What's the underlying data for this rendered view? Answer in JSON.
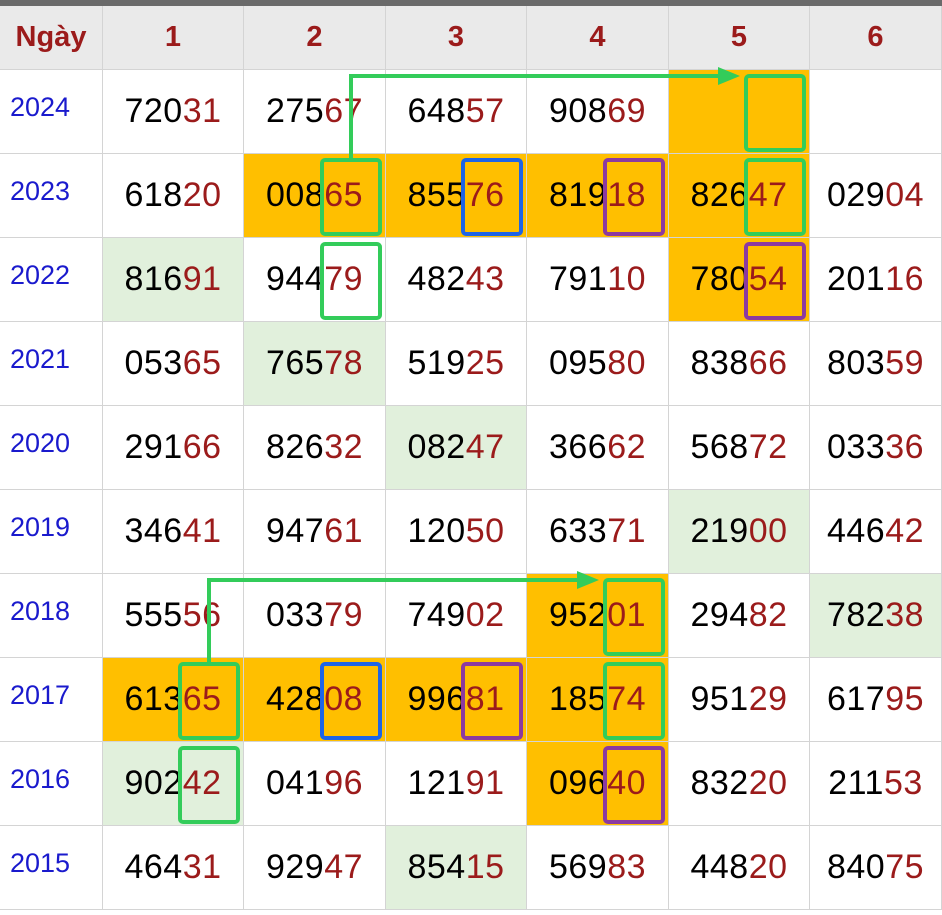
{
  "header": {
    "day_label": "Ngày",
    "columns": [
      "1",
      "2",
      "3",
      "4",
      "5",
      "6"
    ]
  },
  "rows": [
    {
      "year": "2024",
      "cells": [
        {
          "head": "720",
          "tail": "31",
          "bg": "white"
        },
        {
          "head": "275",
          "tail": "67",
          "bg": "white"
        },
        {
          "head": "648",
          "tail": "57",
          "bg": "white"
        },
        {
          "head": "908",
          "tail": "69",
          "bg": "white"
        },
        {
          "head": "",
          "tail": "",
          "bg": "gold"
        },
        {
          "head": "",
          "tail": "",
          "bg": "white"
        }
      ]
    },
    {
      "year": "2023",
      "cells": [
        {
          "head": "618",
          "tail": "20",
          "bg": "white"
        },
        {
          "head": "008",
          "tail": "65",
          "bg": "gold"
        },
        {
          "head": "855",
          "tail": "76",
          "bg": "gold"
        },
        {
          "head": "819",
          "tail": "18",
          "bg": "gold"
        },
        {
          "head": "826",
          "tail": "47",
          "bg": "gold"
        },
        {
          "head": "029",
          "tail": "04",
          "bg": "white"
        }
      ]
    },
    {
      "year": "2022",
      "cells": [
        {
          "head": "816",
          "tail": "91",
          "bg": "mint"
        },
        {
          "head": "944",
          "tail": "79",
          "bg": "white"
        },
        {
          "head": "482",
          "tail": "43",
          "bg": "white"
        },
        {
          "head": "791",
          "tail": "10",
          "bg": "white"
        },
        {
          "head": "780",
          "tail": "54",
          "bg": "gold"
        },
        {
          "head": "201",
          "tail": "16",
          "bg": "white"
        }
      ]
    },
    {
      "year": "2021",
      "cells": [
        {
          "head": "053",
          "tail": "65",
          "bg": "white"
        },
        {
          "head": "765",
          "tail": "78",
          "bg": "mint"
        },
        {
          "head": "519",
          "tail": "25",
          "bg": "white"
        },
        {
          "head": "095",
          "tail": "80",
          "bg": "white"
        },
        {
          "head": "838",
          "tail": "66",
          "bg": "white"
        },
        {
          "head": "803",
          "tail": "59",
          "bg": "white"
        }
      ]
    },
    {
      "year": "2020",
      "cells": [
        {
          "head": "291",
          "tail": "66",
          "bg": "white"
        },
        {
          "head": "826",
          "tail": "32",
          "bg": "white"
        },
        {
          "head": "082",
          "tail": "47",
          "bg": "mint"
        },
        {
          "head": "366",
          "tail": "62",
          "bg": "white"
        },
        {
          "head": "568",
          "tail": "72",
          "bg": "white"
        },
        {
          "head": "033",
          "tail": "36",
          "bg": "white"
        }
      ]
    },
    {
      "year": "2019",
      "cells": [
        {
          "head": "346",
          "tail": "41",
          "bg": "white"
        },
        {
          "head": "947",
          "tail": "61",
          "bg": "white"
        },
        {
          "head": "120",
          "tail": "50",
          "bg": "white"
        },
        {
          "head": "633",
          "tail": "71",
          "bg": "white"
        },
        {
          "head": "219",
          "tail": "00",
          "bg": "mint"
        },
        {
          "head": "446",
          "tail": "42",
          "bg": "white"
        }
      ]
    },
    {
      "year": "2018",
      "cells": [
        {
          "head": "555",
          "tail": "56",
          "bg": "white"
        },
        {
          "head": "033",
          "tail": "79",
          "bg": "white"
        },
        {
          "head": "749",
          "tail": "02",
          "bg": "white"
        },
        {
          "head": "952",
          "tail": "01",
          "bg": "gold"
        },
        {
          "head": "294",
          "tail": "82",
          "bg": "white"
        },
        {
          "head": "782",
          "tail": "38",
          "bg": "mint"
        }
      ]
    },
    {
      "year": "2017",
      "cells": [
        {
          "head": "613",
          "tail": "65",
          "bg": "gold"
        },
        {
          "head": "428",
          "tail": "08",
          "bg": "gold"
        },
        {
          "head": "996",
          "tail": "81",
          "bg": "gold"
        },
        {
          "head": "185",
          "tail": "74",
          "bg": "gold"
        },
        {
          "head": "951",
          "tail": "29",
          "bg": "white"
        },
        {
          "head": "617",
          "tail": "95",
          "bg": "white"
        }
      ]
    },
    {
      "year": "2016",
      "cells": [
        {
          "head": "902",
          "tail": "42",
          "bg": "mint"
        },
        {
          "head": "041",
          "tail": "96",
          "bg": "white"
        },
        {
          "head": "121",
          "tail": "91",
          "bg": "white"
        },
        {
          "head": "096",
          "tail": "40",
          "bg": "gold"
        },
        {
          "head": "832",
          "tail": "20",
          "bg": "white"
        },
        {
          "head": "211",
          "tail": "53",
          "bg": "white"
        }
      ]
    },
    {
      "year": "2015",
      "cells": [
        {
          "head": "464",
          "tail": "31",
          "bg": "white"
        },
        {
          "head": "929",
          "tail": "47",
          "bg": "white"
        },
        {
          "head": "854",
          "tail": "15",
          "bg": "mint"
        },
        {
          "head": "569",
          "tail": "83",
          "bg": "white"
        },
        {
          "head": "448",
          "tail": "20",
          "bg": "white"
        },
        {
          "head": "840",
          "tail": "75",
          "bg": "white"
        }
      ]
    }
  ],
  "highlights": [
    {
      "row": 0,
      "col": 4,
      "color": "green"
    },
    {
      "row": 1,
      "col": 4,
      "color": "green"
    },
    {
      "row": 1,
      "col": 1,
      "color": "green"
    },
    {
      "row": 2,
      "col": 1,
      "color": "green"
    },
    {
      "row": 1,
      "col": 2,
      "color": "blue"
    },
    {
      "row": 1,
      "col": 3,
      "color": "purple"
    },
    {
      "row": 2,
      "col": 4,
      "color": "purple"
    },
    {
      "row": 6,
      "col": 3,
      "color": "green"
    },
    {
      "row": 7,
      "col": 3,
      "color": "green"
    },
    {
      "row": 7,
      "col": 0,
      "color": "green"
    },
    {
      "row": 8,
      "col": 0,
      "color": "green"
    },
    {
      "row": 7,
      "col": 1,
      "color": "blue"
    },
    {
      "row": 7,
      "col": 2,
      "color": "purple"
    },
    {
      "row": 8,
      "col": 3,
      "color": "purple"
    }
  ],
  "arrows": [
    {
      "from_row": 1,
      "from_col": 1,
      "to_row": 0,
      "to_col": 4,
      "color": "green"
    },
    {
      "from_row": 7,
      "from_col": 0,
      "to_row": 6,
      "to_col": 3,
      "color": "green"
    }
  ],
  "colors": {
    "gold": "#ffbf00",
    "mint": "#e1f0dc",
    "green": "#33cc5a",
    "blue": "#1e64e6",
    "purple": "#8b3aa0",
    "tail_red": "#9b1b1b",
    "year_blue": "#1a1acd"
  }
}
